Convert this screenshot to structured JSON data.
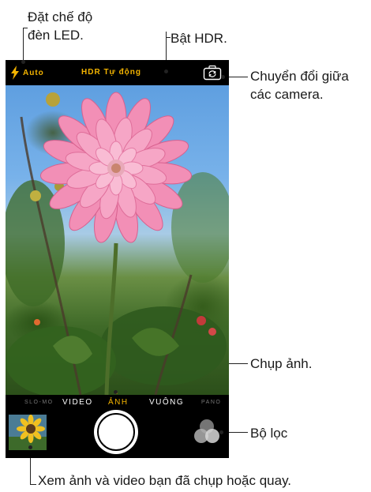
{
  "callouts": {
    "led": [
      "Đặt chế độ",
      "đèn LED."
    ],
    "hdr": "Bật HDR.",
    "switch_camera": [
      "Chuyển đổi giữa",
      "các camera."
    ],
    "capture": "Chụp ảnh.",
    "filters": "Bộ lọc",
    "photos": "Xem ảnh và video bạn đã chụp hoặc quay."
  },
  "camera": {
    "flash_label": "Auto",
    "hdr_label": "HDR Tự động",
    "modes": [
      "SLO-MO",
      "VIDEO",
      "ẢNH",
      "VUÔNG",
      "PANO"
    ],
    "active_mode": "ẢNH"
  },
  "colors": {
    "accent": "#f4b400",
    "bar_background": "#000000"
  }
}
